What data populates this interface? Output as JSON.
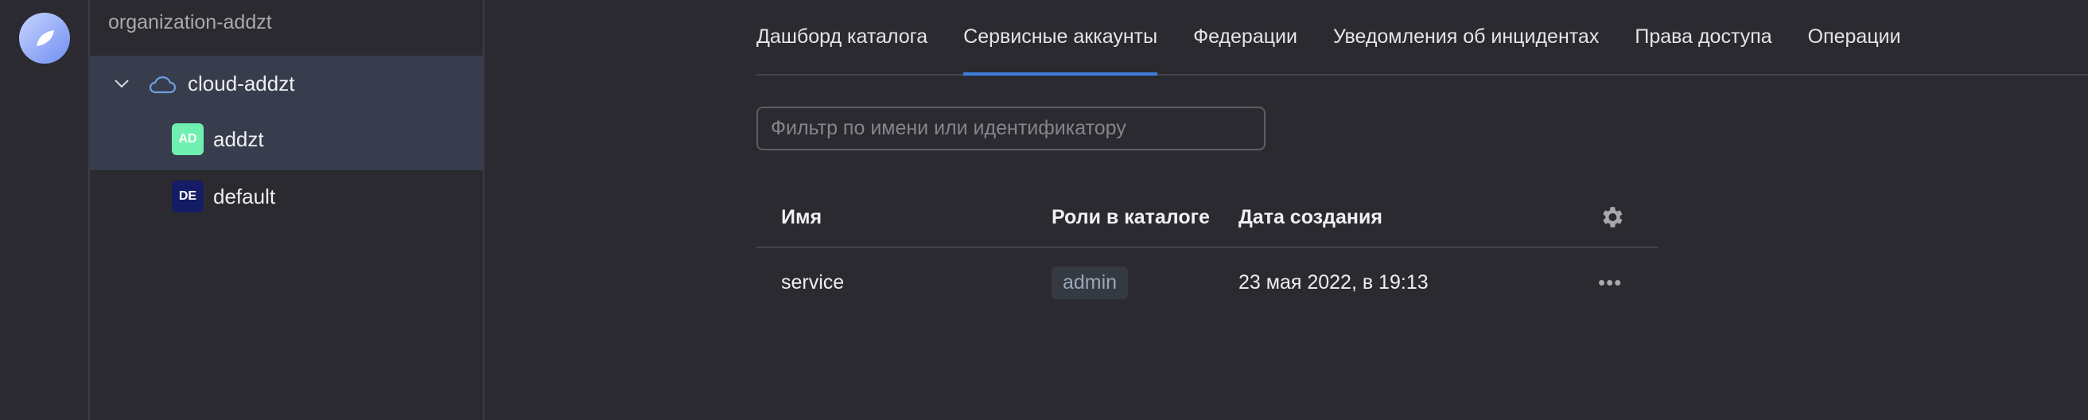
{
  "sidebar": {
    "organization": "organization-addzt",
    "cloud": {
      "label": "cloud-addzt",
      "icon": "cloud-icon",
      "expanded": true
    },
    "folders": [
      {
        "badge": "AD",
        "label": "addzt",
        "badge_color": "#6ff0b0",
        "selected": true
      },
      {
        "badge": "DE",
        "label": "default",
        "badge_color": "#141c66",
        "selected": false
      }
    ]
  },
  "tabs": [
    {
      "label": "Дашборд каталога",
      "active": false
    },
    {
      "label": "Сервисные аккаунты",
      "active": true
    },
    {
      "label": "Федерации",
      "active": false
    },
    {
      "label": "Уведомления об инцидентах",
      "active": false
    },
    {
      "label": "Права доступа",
      "active": false
    },
    {
      "label": "Операции",
      "active": false
    }
  ],
  "filter": {
    "placeholder": "Фильтр по имени или идентификатору",
    "value": ""
  },
  "table": {
    "columns": [
      "Имя",
      "Роли в каталоге",
      "Дата создания"
    ],
    "rows": [
      {
        "name": "service",
        "role": "admin",
        "created": "23 мая 2022, в 19:13"
      }
    ]
  },
  "colors": {
    "accent": "#3d7fe0",
    "background": "#2b2a30",
    "selected": "#373d4c"
  }
}
